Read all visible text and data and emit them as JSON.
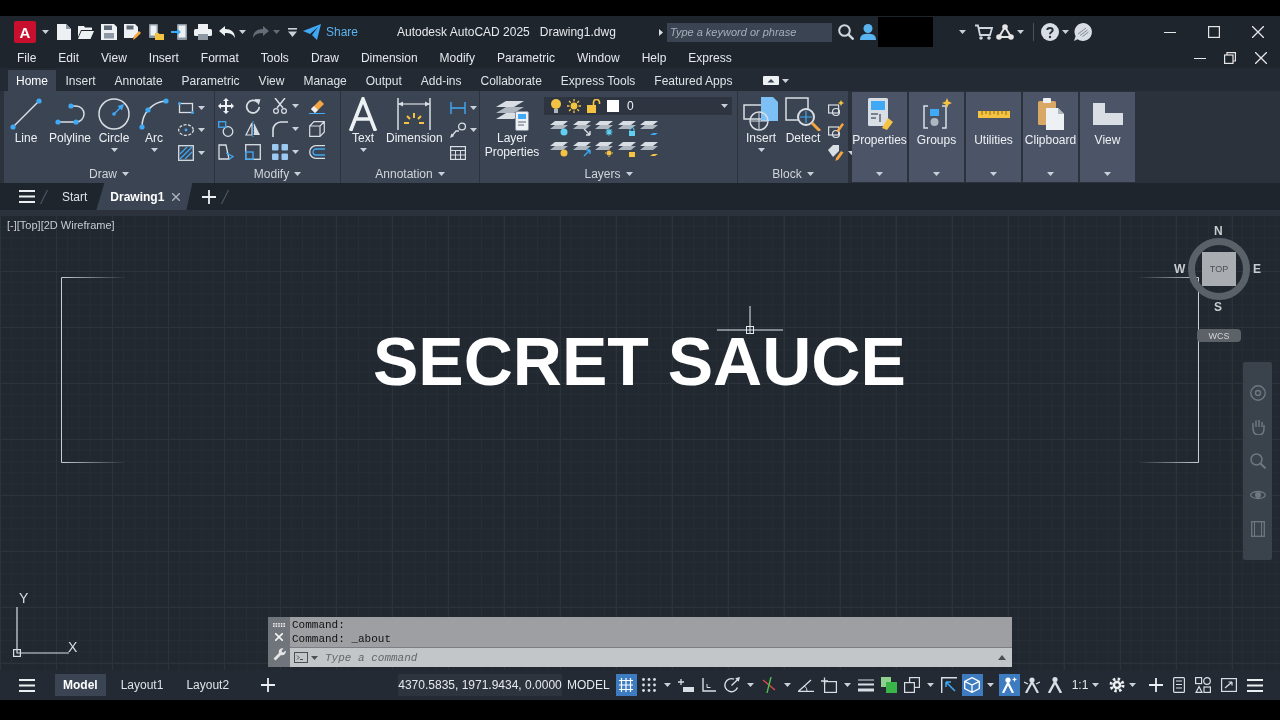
{
  "title_bar": {
    "app_logo": "A",
    "quick_access": [
      {
        "kind": "new",
        "disabled": false
      },
      {
        "kind": "open",
        "disabled": false
      },
      {
        "kind": "save",
        "disabled": false
      },
      {
        "kind": "save_as",
        "disabled": false
      },
      {
        "kind": "open_web",
        "disabled": false
      },
      {
        "kind": "save_web",
        "disabled": false
      },
      {
        "kind": "plot",
        "disabled": false
      },
      {
        "kind": "undo",
        "disabled": false
      },
      {
        "kind": "redo",
        "disabled": true
      }
    ],
    "share": "Share",
    "app_title": "Autodesk AutoCAD 2025",
    "file_name": "Drawing1.dwg",
    "search": {
      "placeholder": "Type a keyword or phrase"
    }
  },
  "menu_bar": [
    "File",
    "Edit",
    "View",
    "Insert",
    "Format",
    "Tools",
    "Draw",
    "Dimension",
    "Modify",
    "Parametric",
    "Window",
    "Help",
    "Express"
  ],
  "ribbon": {
    "tabs": [
      {
        "label": "Home",
        "selected": true
      },
      {
        "label": "Insert",
        "selected": false
      },
      {
        "label": "Annotate",
        "selected": false
      },
      {
        "label": "Parametric",
        "selected": false
      },
      {
        "label": "View",
        "selected": false
      },
      {
        "label": "Manage",
        "selected": false
      },
      {
        "label": "Output",
        "selected": false
      },
      {
        "label": "Add-ins",
        "selected": false
      },
      {
        "label": "Collaborate",
        "selected": false
      },
      {
        "label": "Express Tools",
        "selected": false
      },
      {
        "label": "Featured Apps",
        "selected": false
      }
    ],
    "panels": [
      {
        "kind": "draw",
        "title": "Draw",
        "tools": [
          {
            "kind": "line",
            "label": "Line",
            "dropdown": false
          },
          {
            "kind": "polyline",
            "label": "Polyline",
            "dropdown": false
          },
          {
            "kind": "circle",
            "label": "Circle",
            "dropdown": true
          },
          {
            "kind": "arc",
            "label": "Arc",
            "dropdown": true
          }
        ]
      },
      {
        "kind": "modify",
        "title": "Modify"
      },
      {
        "kind": "annotation",
        "title": "Annotation",
        "tools": [
          {
            "kind": "text",
            "label": "Text",
            "dropdown": true
          },
          {
            "kind": "dimension",
            "label": "Dimension",
            "dropdown": false
          }
        ]
      },
      {
        "kind": "layers",
        "title": "Layers",
        "tools": [
          {
            "kind": "layer_properties",
            "label": "Layer Properties",
            "dropdown": false
          }
        ],
        "current_layer": "0"
      },
      {
        "kind": "block",
        "title": "Block",
        "tools": [
          {
            "kind": "insert",
            "label": "Insert",
            "dropdown": true
          },
          {
            "kind": "detect",
            "label": "Detect",
            "dropdown": false
          }
        ]
      }
    ],
    "collapsed_panels": [
      {
        "kind": "properties",
        "label": "Properties"
      },
      {
        "kind": "groups",
        "label": "Groups"
      },
      {
        "kind": "utilities",
        "label": "Utilities"
      },
      {
        "kind": "clipboard",
        "label": "Clipboard"
      },
      {
        "kind": "view",
        "label": "View"
      }
    ]
  },
  "file_tabs": [
    {
      "label": "Start",
      "selected": false
    },
    {
      "label": "Drawing1",
      "selected": true
    }
  ],
  "viewport": {
    "controls": [
      "[-]",
      "[Top]",
      "[2D Wireframe]"
    ],
    "drawing_text": "SECRET SAUCE",
    "viewcube": {
      "north": "N",
      "west": "W",
      "east": "E",
      "south": "S",
      "face": "TOP",
      "coordinate_system": "WCS"
    },
    "ucs": {
      "y_label": "Y",
      "x_label": "X"
    }
  },
  "command_line": {
    "history": [
      "Command:",
      "Command: _about"
    ],
    "input": {
      "placeholder": "Type a command"
    }
  },
  "status_bar": {
    "layout_tabs": [
      {
        "label": "Model",
        "selected": true
      },
      {
        "label": "Layout1",
        "selected": false
      },
      {
        "label": "Layout2",
        "selected": false
      }
    ],
    "coordinates": "4370.5835, 1971.9434, 0.0000",
    "space": "MODEL",
    "toggles": [
      {
        "kind": "grid",
        "on": true
      },
      {
        "kind": "snap",
        "on": false
      },
      {
        "kind": "dynamic_input",
        "on": false
      },
      {
        "kind": "ortho",
        "on": false
      },
      {
        "kind": "polar",
        "on": false
      },
      {
        "kind": "isodraft",
        "on": false
      },
      {
        "kind": "object_snap_tracking",
        "on": false
      },
      {
        "kind": "object_snap",
        "on": false
      },
      {
        "kind": "lineweight",
        "on": false
      },
      {
        "kind": "transparency",
        "on": false
      },
      {
        "kind": "selection_cycling",
        "on": false
      },
      {
        "kind": "osnap_3d",
        "on": false
      },
      {
        "kind": "dynamic_ucs",
        "on": true
      },
      {
        "kind": "annotation_visibility",
        "on": true
      },
      {
        "kind": "auto_scale",
        "on": false
      },
      {
        "kind": "annotation_scale",
        "on": false
      }
    ],
    "annotation_scale": "1:1",
    "tools": [
      {
        "kind": "workspace",
        "dropdown": true
      },
      {
        "kind": "annotation_monitor",
        "dropdown": false
      },
      {
        "kind": "units",
        "dropdown": false
      },
      {
        "kind": "quick_properties",
        "dropdown": false
      },
      {
        "kind": "clean_screen",
        "dropdown": false
      },
      {
        "kind": "customize",
        "dropdown": false
      }
    ]
  }
}
